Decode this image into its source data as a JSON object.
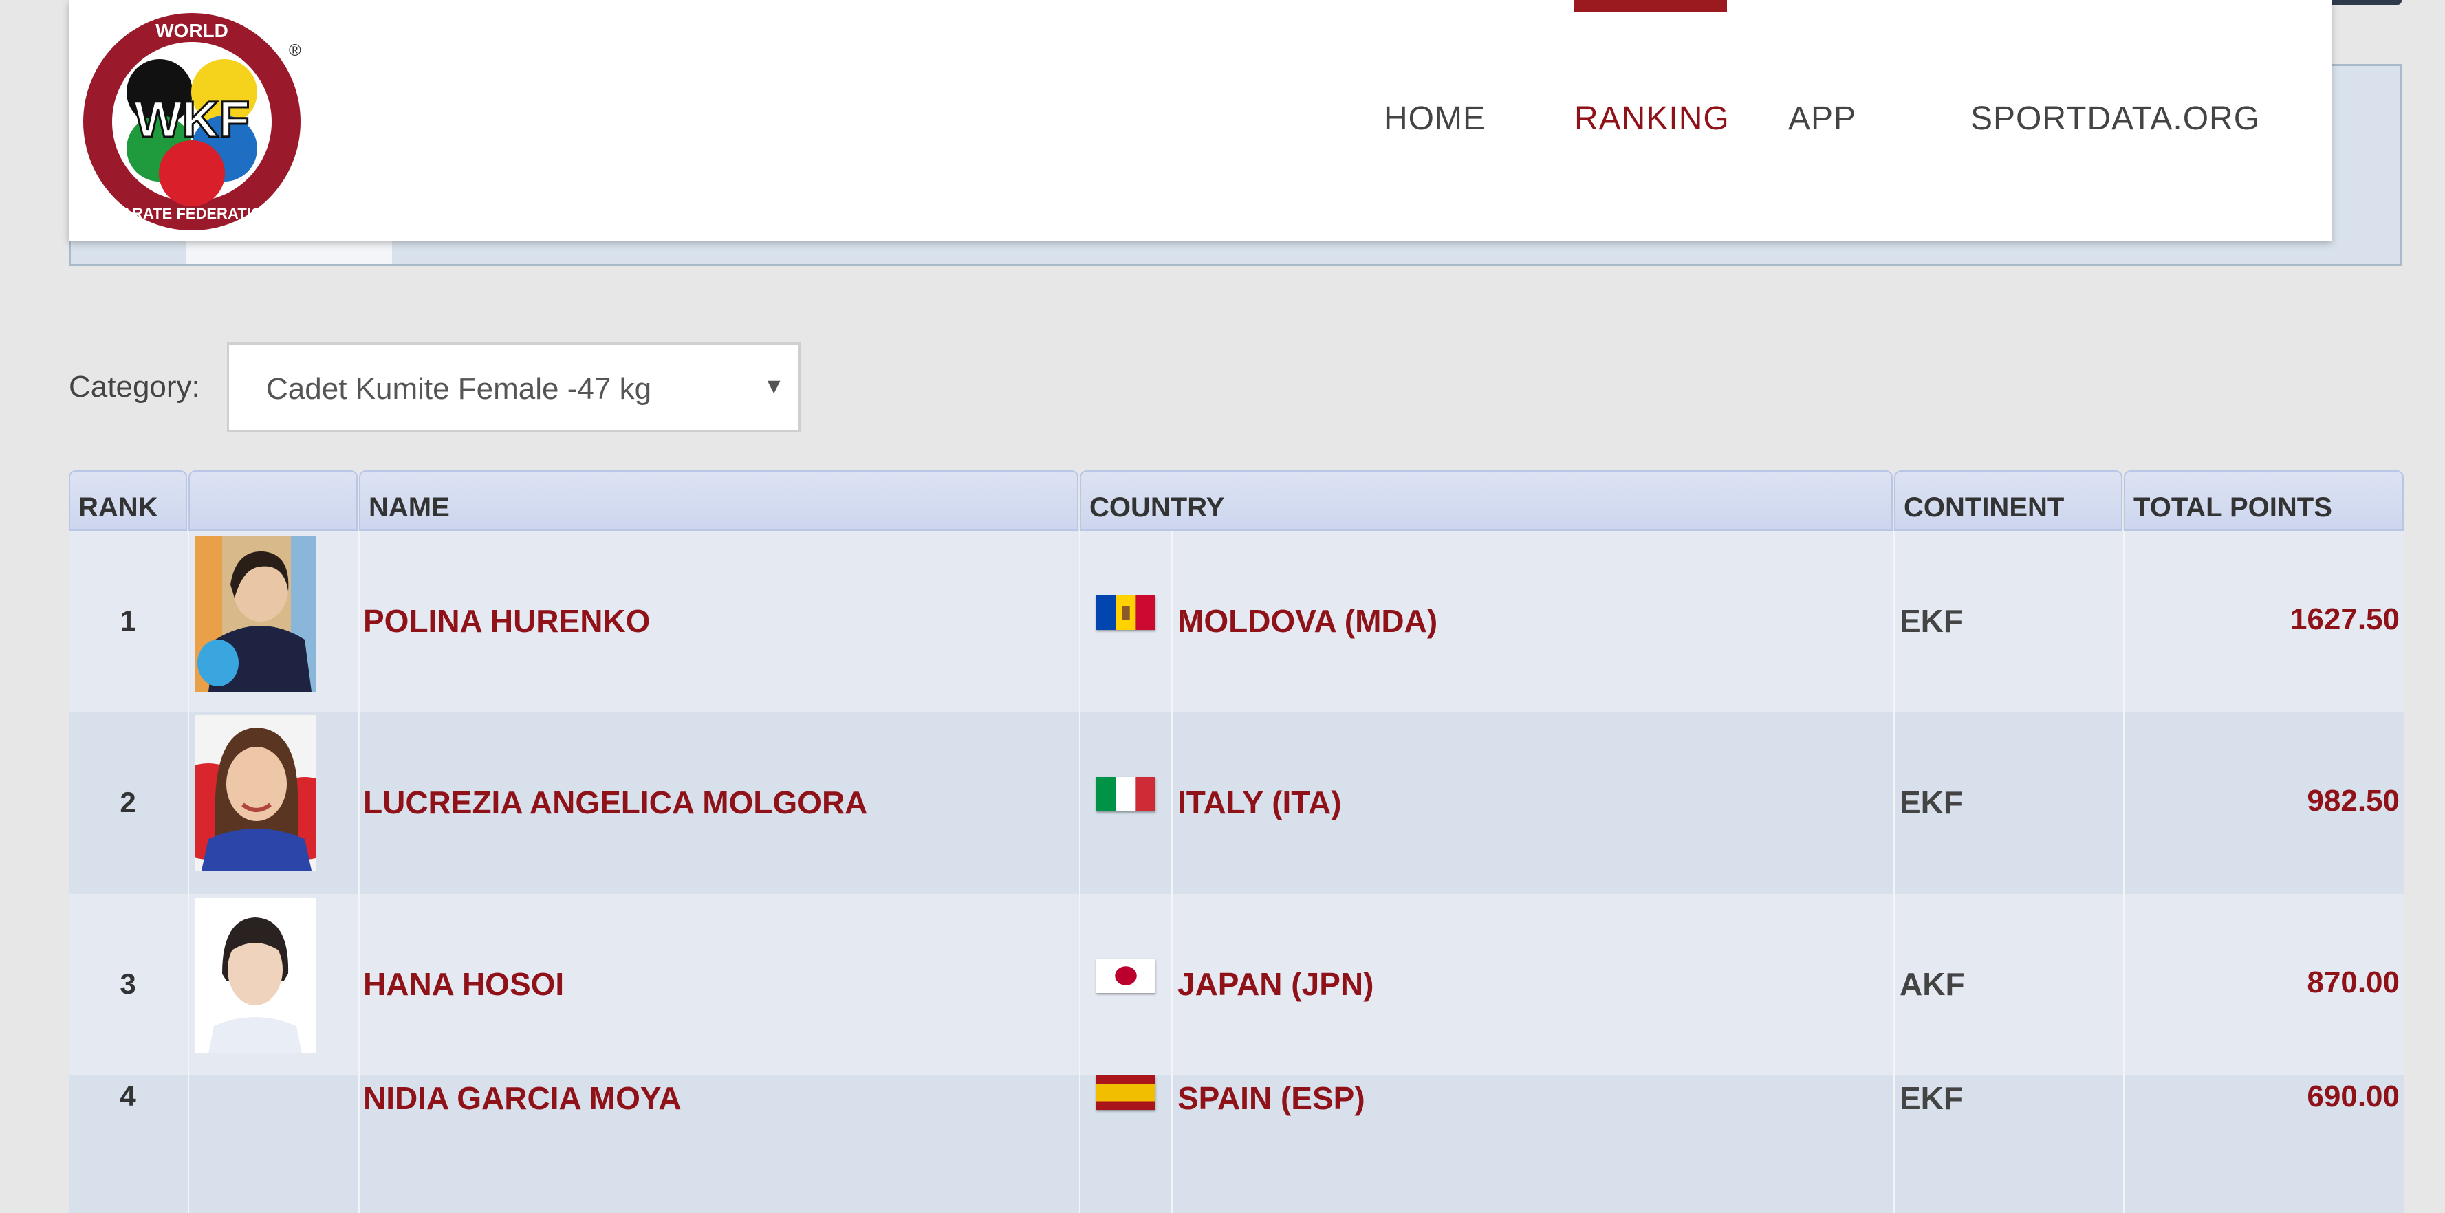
{
  "header": {
    "logo": {
      "top_text": "WORLD",
      "initials": "WKF",
      "bottom_text": "KARATE FEDERATION",
      "registered": "®"
    },
    "nav": [
      {
        "label": "HOME",
        "active": false
      },
      {
        "label": "RANKING",
        "active": true
      },
      {
        "label": "APP",
        "active": false
      },
      {
        "label": "SPORTDATA.ORG",
        "active": false
      }
    ]
  },
  "filter": {
    "category_label": "Category:",
    "category_value": "Cadet Kumite Female -47 kg",
    "dropdown_icon": "triangle-down-icon"
  },
  "table": {
    "headers": {
      "rank": "RANK",
      "photo": "",
      "name": "NAME",
      "country": "COUNTRY",
      "continent": "CONTINENT",
      "total_points": "TOTAL POINTS"
    },
    "rows": [
      {
        "rank": "1",
        "name": "POLINA HURENKO",
        "flag": "moldova-flag",
        "country": "MOLDOVA (MDA)",
        "continent": "EKF",
        "points": "1627.50"
      },
      {
        "rank": "2",
        "name": "LUCREZIA ANGELICA MOLGORA",
        "flag": "italy-flag",
        "country": "ITALY (ITA)",
        "continent": "EKF",
        "points": "982.50"
      },
      {
        "rank": "3",
        "name": "HANA HOSOI",
        "flag": "japan-flag",
        "country": "JAPAN (JPN)",
        "continent": "AKF",
        "points": "870.00"
      },
      {
        "rank": "4",
        "name": "NIDIA GARCIA MOYA",
        "flag": "spain-flag",
        "country": "SPAIN (ESP)",
        "continent": "EKF",
        "points": "690.00"
      }
    ]
  },
  "colors": {
    "brand_red": "#8f1219",
    "header_bg": "#dde3f3",
    "row_odd": "#e5eaf2",
    "row_even": "#d7e0eb"
  }
}
